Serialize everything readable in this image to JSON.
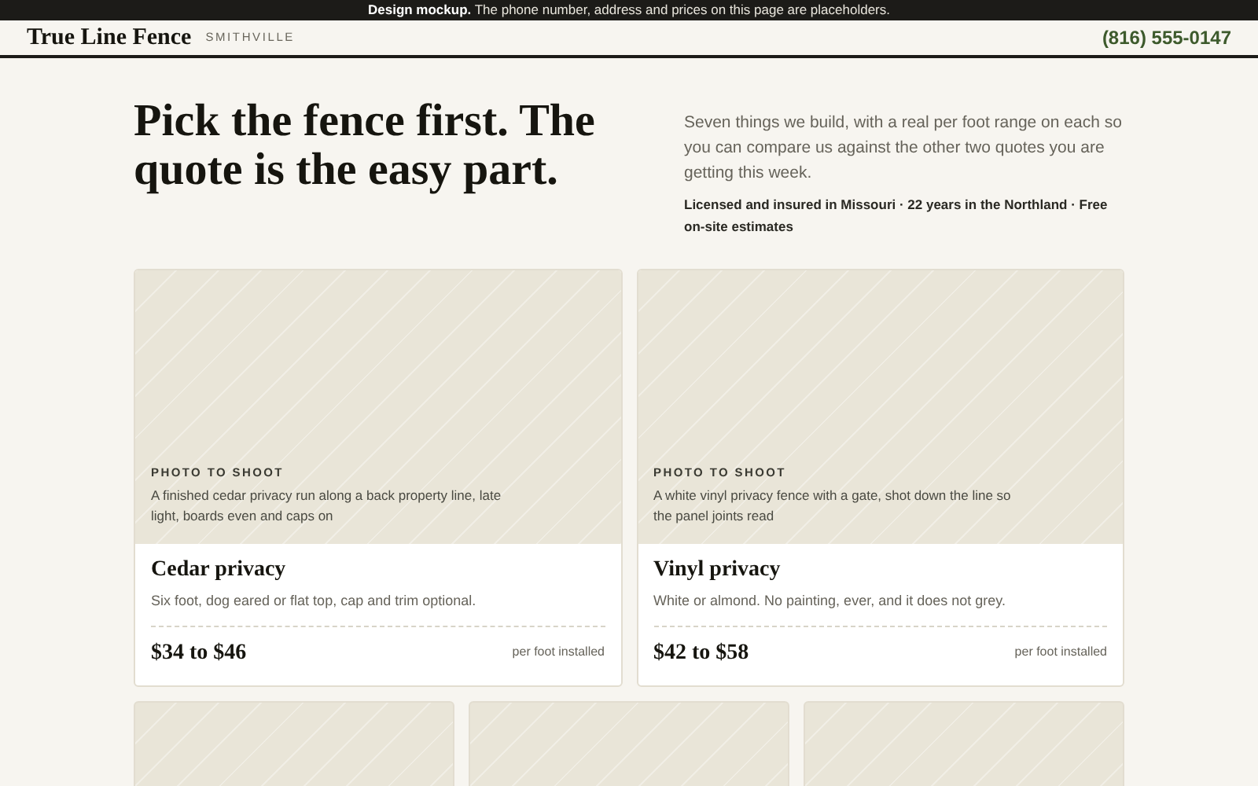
{
  "notice": "**Design mockup.** The phone number, address and prices on this page are placeholders.",
  "header": {
    "brand": "True Line Fence",
    "location": "SMITHVILLE",
    "phone": "(816) 555-0147"
  },
  "hero": {
    "headline": "Pick the fence first. The quote is the easy part.",
    "intro": "Seven things we build, with a real per foot range on each so you can compare us against the other two quotes you are getting this week.",
    "credentials": "Licensed and insured in Missouri · 22 years in the Northland · Free on-site estimates"
  },
  "cards": [
    {
      "kind": "product",
      "photo_label": "PHOTO TO SHOOT",
      "photo_note": "A finished cedar privacy run along a back property line, late light, boards even and caps on",
      "title": "Cedar privacy",
      "description": "Six foot, dog eared or flat top, cap and trim optional.",
      "price": "$34 to $46",
      "unit": "per foot installed"
    },
    {
      "kind": "product",
      "photo_label": "PHOTO TO SHOOT",
      "photo_note": "A white vinyl privacy fence with a gate, shot down the line so the panel joints read",
      "title": "Vinyl privacy",
      "description": "White or almond. No painting, ever, and it does not grey.",
      "price": "$42 to $58",
      "unit": "per foot installed"
    },
    {
      "kind": "placeholder"
    },
    {
      "kind": "placeholder"
    },
    {
      "kind": "placeholder"
    }
  ]
}
